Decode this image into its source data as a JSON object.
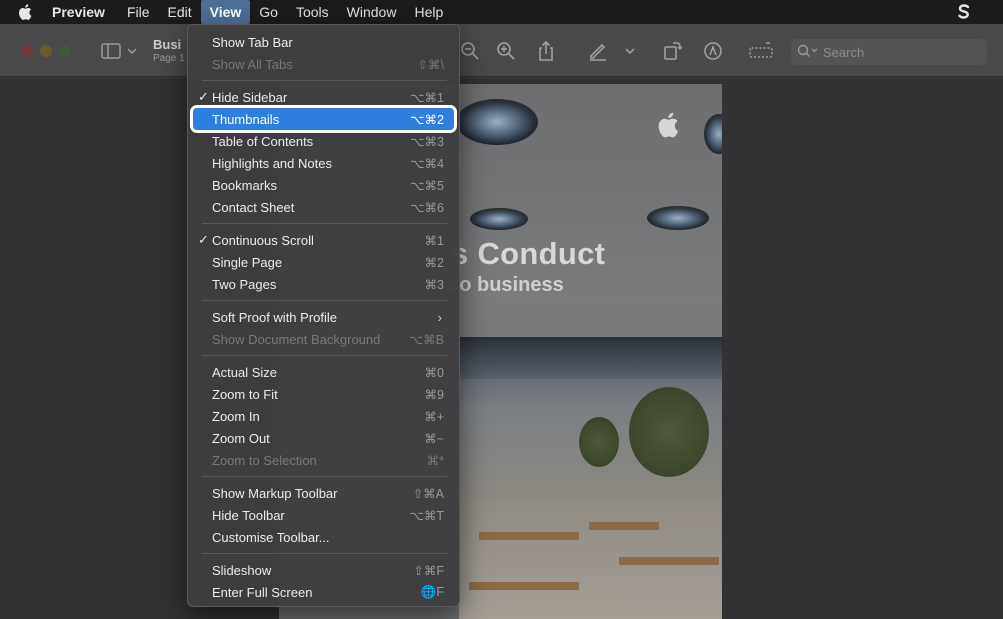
{
  "menubar": {
    "apple_icon": "apple-logo-icon",
    "items": [
      {
        "label": "Preview"
      },
      {
        "label": "File"
      },
      {
        "label": "Edit"
      },
      {
        "label": "View"
      },
      {
        "label": "Go"
      },
      {
        "label": "Tools"
      },
      {
        "label": "Window"
      },
      {
        "label": "Help"
      }
    ],
    "right_icon": "scrivener-s-icon"
  },
  "window": {
    "title": "Busi",
    "subtitle": "Page 1",
    "search_placeholder": "Search",
    "toolbar_icons": [
      "sidebar-toggle-icon",
      "zoom-out-icon",
      "zoom-in-icon",
      "share-icon",
      "markup-pen-icon",
      "rotate-icon",
      "annotate-icon",
      "form-fill-icon",
      "search-icon"
    ]
  },
  "document": {
    "heading": "s Conduct",
    "subheading": "do business"
  },
  "view_menu": {
    "items": [
      {
        "label": "Show Tab Bar",
        "shortcut": "",
        "checked": false,
        "disabled": false
      },
      {
        "label": "Show All Tabs",
        "shortcut": "⇧⌘\\",
        "checked": false,
        "disabled": true
      },
      {
        "label": "Hide Sidebar",
        "shortcut": "⌥⌘1",
        "checked": true,
        "disabled": false
      },
      {
        "label": "Thumbnails",
        "shortcut": "⌥⌘2",
        "checked": false,
        "disabled": false,
        "highlighted": true
      },
      {
        "label": "Table of Contents",
        "shortcut": "⌥⌘3",
        "checked": false,
        "disabled": false
      },
      {
        "label": "Highlights and Notes",
        "shortcut": "⌥⌘4",
        "checked": false,
        "disabled": false
      },
      {
        "label": "Bookmarks",
        "shortcut": "⌥⌘5",
        "checked": false,
        "disabled": false
      },
      {
        "label": "Contact Sheet",
        "shortcut": "⌥⌘6",
        "checked": false,
        "disabled": false
      },
      {
        "label": "Continuous Scroll",
        "shortcut": "⌘1",
        "checked": true,
        "disabled": false
      },
      {
        "label": "Single Page",
        "shortcut": "⌘2",
        "checked": false,
        "disabled": false
      },
      {
        "label": "Two Pages",
        "shortcut": "⌘3",
        "checked": false,
        "disabled": false
      },
      {
        "label": "Soft Proof with Profile",
        "shortcut": "",
        "checked": false,
        "disabled": false,
        "submenu": true
      },
      {
        "label": "Show Document Background",
        "shortcut": "⌥⌘B",
        "checked": false,
        "disabled": true
      },
      {
        "label": "Actual Size",
        "shortcut": "⌘0",
        "checked": false,
        "disabled": false
      },
      {
        "label": "Zoom to Fit",
        "shortcut": "⌘9",
        "checked": false,
        "disabled": false
      },
      {
        "label": "Zoom In",
        "shortcut": "⌘+",
        "checked": false,
        "disabled": false
      },
      {
        "label": "Zoom Out",
        "shortcut": "⌘−",
        "checked": false,
        "disabled": false
      },
      {
        "label": "Zoom to Selection",
        "shortcut": "⌘*",
        "checked": false,
        "disabled": true
      },
      {
        "label": "Show Markup Toolbar",
        "shortcut": "⇧⌘A",
        "checked": false,
        "disabled": false
      },
      {
        "label": "Hide Toolbar",
        "shortcut": "⌥⌘T",
        "checked": false,
        "disabled": false
      },
      {
        "label": "Customise Toolbar...",
        "shortcut": "",
        "checked": false,
        "disabled": false
      },
      {
        "label": "Slideshow",
        "shortcut": "⇧⌘F",
        "checked": false,
        "disabled": false
      },
      {
        "label": "Enter Full Screen",
        "shortcut": "🌐F",
        "checked": false,
        "disabled": false
      }
    ],
    "check_glyph": "✓",
    "submenu_glyph": "›"
  },
  "colors": {
    "highlight": "#2f7fdf",
    "menu_bg": "#3e3e40",
    "menubar_active": "#4f6f96"
  }
}
